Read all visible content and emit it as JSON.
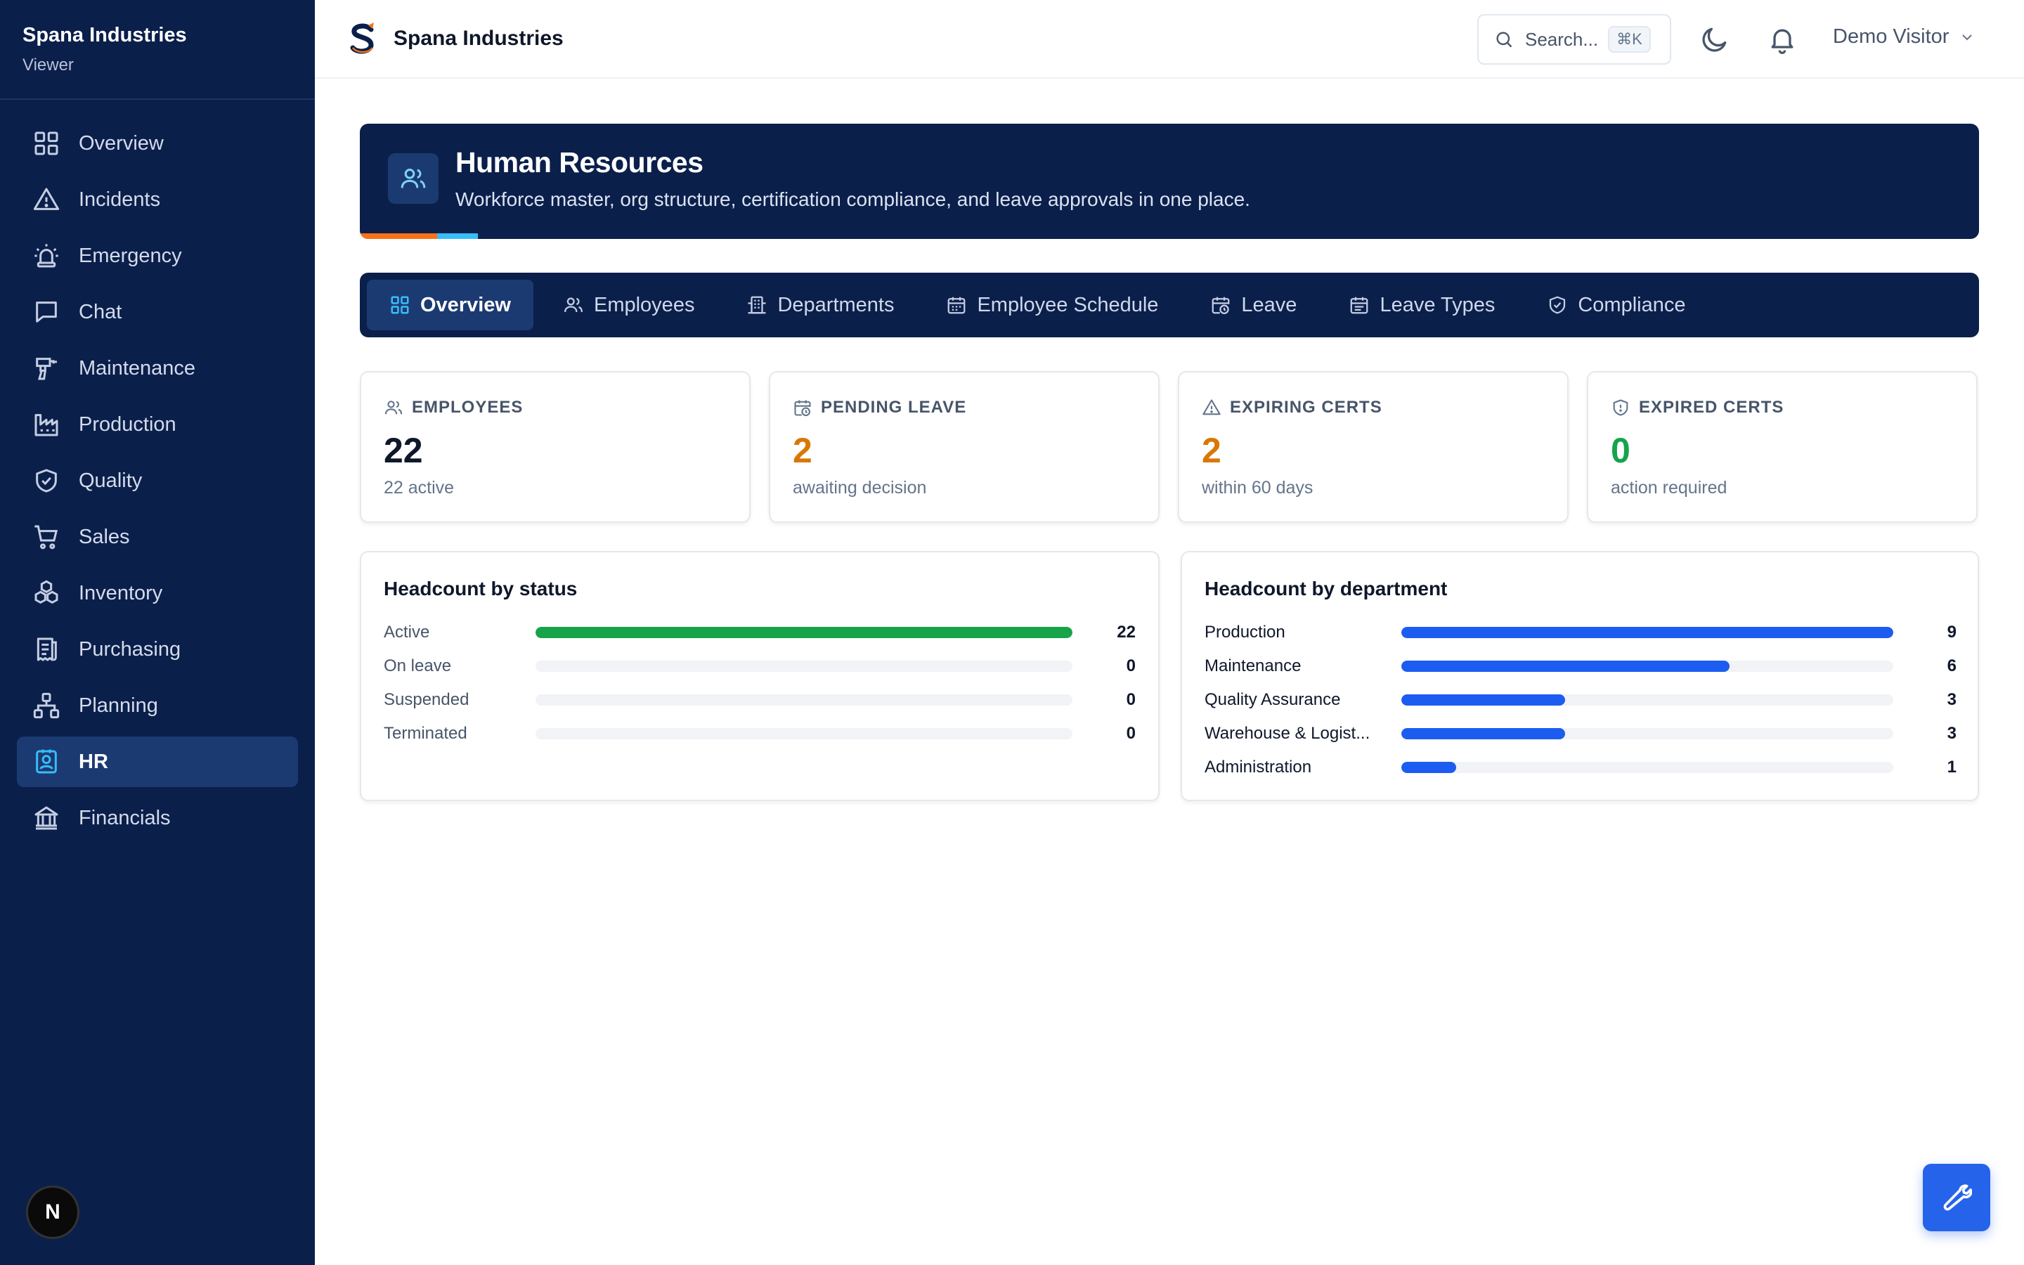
{
  "sidebar": {
    "brand_name": "Spana Industries",
    "role": "Viewer",
    "items": [
      {
        "label": "Overview",
        "icon": "grid-icon"
      },
      {
        "label": "Incidents",
        "icon": "warning-triangle-icon"
      },
      {
        "label": "Emergency",
        "icon": "siren-icon"
      },
      {
        "label": "Chat",
        "icon": "chat-bubble-icon"
      },
      {
        "label": "Maintenance",
        "icon": "drill-icon"
      },
      {
        "label": "Production",
        "icon": "factory-icon"
      },
      {
        "label": "Quality",
        "icon": "shield-check-icon"
      },
      {
        "label": "Sales",
        "icon": "cart-icon"
      },
      {
        "label": "Inventory",
        "icon": "boxes-icon"
      },
      {
        "label": "Purchasing",
        "icon": "receipt-icon"
      },
      {
        "label": "Planning",
        "icon": "network-icon"
      },
      {
        "label": "HR",
        "icon": "contact-card-icon",
        "active": true
      },
      {
        "label": "Financials",
        "icon": "bank-icon"
      }
    ],
    "footer_badge": "N"
  },
  "header": {
    "title": "Spana Industries",
    "search_placeholder": "Search...",
    "search_shortcut": "⌘K",
    "user_name": "Demo Visitor"
  },
  "banner": {
    "title": "Human Resources",
    "subtitle": "Workforce master, org structure, certification compliance, and leave approvals in one place."
  },
  "tabs": [
    {
      "label": "Overview",
      "active": true
    },
    {
      "label": "Employees"
    },
    {
      "label": "Departments"
    },
    {
      "label": "Employee Schedule"
    },
    {
      "label": "Leave"
    },
    {
      "label": "Leave Types"
    },
    {
      "label": "Compliance"
    }
  ],
  "kpis": [
    {
      "label": "EMPLOYEES",
      "value": "22",
      "sub": "22 active",
      "color": "#0f172a"
    },
    {
      "label": "PENDING LEAVE",
      "value": "2",
      "sub": "awaiting decision",
      "color": "#d97706"
    },
    {
      "label": "EXPIRING CERTS",
      "value": "2",
      "sub": "within 60 days",
      "color": "#d97706"
    },
    {
      "label": "EXPIRED CERTS",
      "value": "0",
      "sub": "action required",
      "color": "#16a34a"
    }
  ],
  "headcount_status": {
    "title": "Headcount by status",
    "bar_color": "#16a34a",
    "max": 22,
    "rows": [
      {
        "label": "Active",
        "count": 22
      },
      {
        "label": "On leave",
        "count": 0
      },
      {
        "label": "Suspended",
        "count": 0
      },
      {
        "label": "Terminated",
        "count": 0
      }
    ]
  },
  "headcount_department": {
    "title": "Headcount by department",
    "bar_color": "#1d5cf0",
    "max": 9,
    "rows": [
      {
        "label": "Production",
        "count": 9
      },
      {
        "label": "Maintenance",
        "count": 6
      },
      {
        "label": "Quality Assurance",
        "count": 3
      },
      {
        "label": "Warehouse & Logist...",
        "count": 3
      },
      {
        "label": "Administration",
        "count": 1
      }
    ]
  }
}
